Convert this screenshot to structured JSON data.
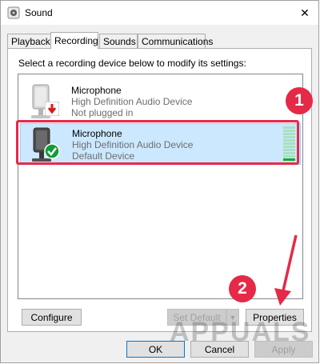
{
  "window": {
    "title": "Sound",
    "icon": "speaker-icon",
    "close_label": "✕"
  },
  "tabs": [
    {
      "label": "Playback",
      "active": false
    },
    {
      "label": "Recording",
      "active": true
    },
    {
      "label": "Sounds",
      "active": false
    },
    {
      "label": "Communications",
      "active": false
    }
  ],
  "panel": {
    "instruction": "Select a recording device below to modify its settings:",
    "devices": [
      {
        "name": "Microphone",
        "description": "High Definition Audio Device",
        "status": "Not plugged in",
        "status_icon": "red-down-arrow-icon",
        "selected": false
      },
      {
        "name": "Microphone",
        "description": "High Definition Audio Device",
        "status": "Default Device",
        "status_icon": "green-check-icon",
        "selected": true
      }
    ]
  },
  "annotations": {
    "step1": "1",
    "step2": "2",
    "color": "#e42a46"
  },
  "buttons": {
    "configure": "Configure",
    "set_default": "Set Default",
    "properties": "Properties",
    "ok": "OK",
    "cancel": "Cancel",
    "apply": "Apply"
  },
  "watermark": "APPUALS"
}
